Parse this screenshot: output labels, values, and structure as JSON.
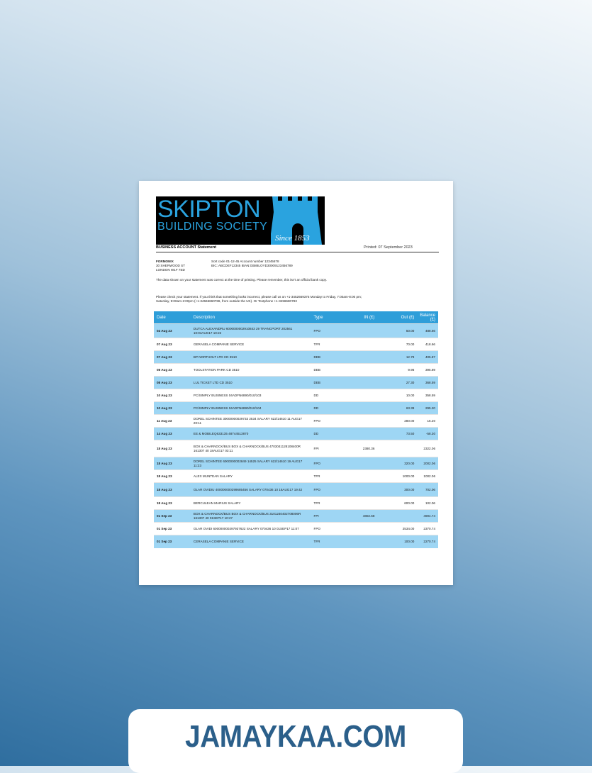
{
  "logo": {
    "name": "SKIPTON",
    "subtitle": "BUILDING SOCIETY",
    "since": "Since 1853"
  },
  "statement": {
    "title": "BUSINESS ACCOUNT Statement",
    "printed": "Printed: 07 September 2023",
    "address_lines": [
      "FORMONIX",
      "30 SHERWOOD ST",
      "LONDON W1F 7ED"
    ],
    "sort_line": "Sort code 01-12-45  Account number 12345678",
    "bic_line": "BIC: ABCDEF12345   IBAN:GB88LOYD30009123456789",
    "note": "The data shown on your statement was correct at the time of printing. Please remember, this isn't an official bank copy.",
    "check": "Please check your statement. If you think that something looks incorrect, please call us on +1-3452669375 Monday to Friday, 7:00am-8:00 pm; Saturday, 9:00am-2:00pm (+1-34566660786, from outside the UK). Or Textphone +1-3456680783"
  },
  "table": {
    "headers": {
      "date": "Date",
      "description": "Description",
      "type": "Type",
      "in": "IN (£)",
      "out": "Out (£)",
      "balance": "Balance (£)"
    },
    "rows": [
      {
        "date": "04 Aug 23",
        "desc": "DUTCA ALEXANDRU 6000000002910843 29 TRANCPORT 202561 10:04AUG17 10:22",
        "type": "FPO",
        "in": "",
        "out": "50.00",
        "bal": "488.66"
      },
      {
        "date": "07 Aug 23",
        "desc": "GERASELA COMPANIE SERVICE",
        "type": "TFR",
        "in": "",
        "out": "70.00",
        "bal": "418.66"
      },
      {
        "date": "07 Aug 23",
        "desc": "BP NORTHOLT LTD CD 3510",
        "type": "DEB",
        "in": "",
        "out": "12.79",
        "bal": "405.87"
      },
      {
        "date": "08 Aug 23",
        "desc": "TOOLSTATION PARK CD 3510",
        "type": "DEB",
        "in": "",
        "out": "9.96",
        "bal": "395.89"
      },
      {
        "date": "08 Aug 23",
        "desc": "LUL TICKET LTD CD 3510",
        "type": "DEB",
        "in": "",
        "out": "27.30",
        "bal": "368.59"
      },
      {
        "date": "10 Aug 23",
        "desc": "PC/SIMPLY BUSINESS 04ADFN6890/010/103",
        "type": "DD",
        "in": "",
        "out": "10.00",
        "bal": "358.59"
      },
      {
        "date": "10 Aug 23",
        "desc": "PC/SIMPLY BUSINESS 04ADFN6890/010/104",
        "type": "DD",
        "in": "",
        "out": "63.39",
        "bal": "295.20"
      },
      {
        "date": "11 Aug 23",
        "desc": "DOREL SCHINTEE 30000000029733 2534 SALARY 622/14610 11 AUG17 20:11",
        "type": "FPO",
        "in": "",
        "out": "280.00",
        "bal": "15.20"
      },
      {
        "date": "14 Aug 23",
        "desc": "EE & MOBILEQ633135 48744513870",
        "type": "DD",
        "in": "",
        "out": "73.50",
        "bal": "-58.30"
      },
      {
        "date": "18 Aug 23",
        "desc": "BOX & CHARNOCK/BUS BOX & CHARNOCK/BUS 4703041128108400R 161307 40 18AUG17 03:11",
        "type": "FPI",
        "in": "2380.36",
        "out": "",
        "bal": "2322.06"
      },
      {
        "date": "18 Aug 23",
        "desc": "DOREL SCHINTEE 6000000002849 14525 SALARY 622/14610 19 AUG17 11:23",
        "type": "FPO",
        "in": "",
        "out": "320.00",
        "bal": "2002.06"
      },
      {
        "date": "18 Aug 23",
        "desc": "ALEX MUNTEAN SALARY",
        "type": "TFR",
        "in": "",
        "out": "1000.00",
        "bal": "1002.06"
      },
      {
        "date": "18 Aug 23",
        "desc": "OLAR OVIDIU 400000000299685456 SALARY 070436 10 18AUG17 19:42",
        "type": "FPO",
        "in": "",
        "out": "300.00",
        "bal": "702.06"
      },
      {
        "date": "18 Aug 23",
        "desc": "BERCULEAN MARIUS SALARY",
        "type": "TFR",
        "in": "",
        "out": "600.00",
        "bal": "102.06"
      },
      {
        "date": "01 Sep 23",
        "desc": "BOX & CHARNOCK/BUS BOX & CHARNOCK/BUS 3101240402708006R 161307 40 01SEP17 10:27",
        "type": "FPI",
        "in": "4802.68",
        "out": "",
        "bal": "4904.74"
      },
      {
        "date": "01 Sep 23",
        "desc": "OLAR OVIDI 600000000297937622 SALARY 070436 10 01SEP17 11:07",
        "type": "FPO",
        "in": "",
        "out": "2534.00",
        "bal": "2370.74"
      },
      {
        "date": "01 Sep 23",
        "desc": "CERASELA COMPANIE SERVICE",
        "type": "TFR",
        "in": "",
        "out": "100.00",
        "bal": "2270.74"
      }
    ]
  },
  "banner": {
    "text": "JAMAYKAA.COM"
  },
  "colors": {
    "header_blue": "#2e9ed9",
    "row_blue": "#9ed6f4",
    "logo_blue": "#2aa3df",
    "banner_text": "#2b5f8a"
  }
}
